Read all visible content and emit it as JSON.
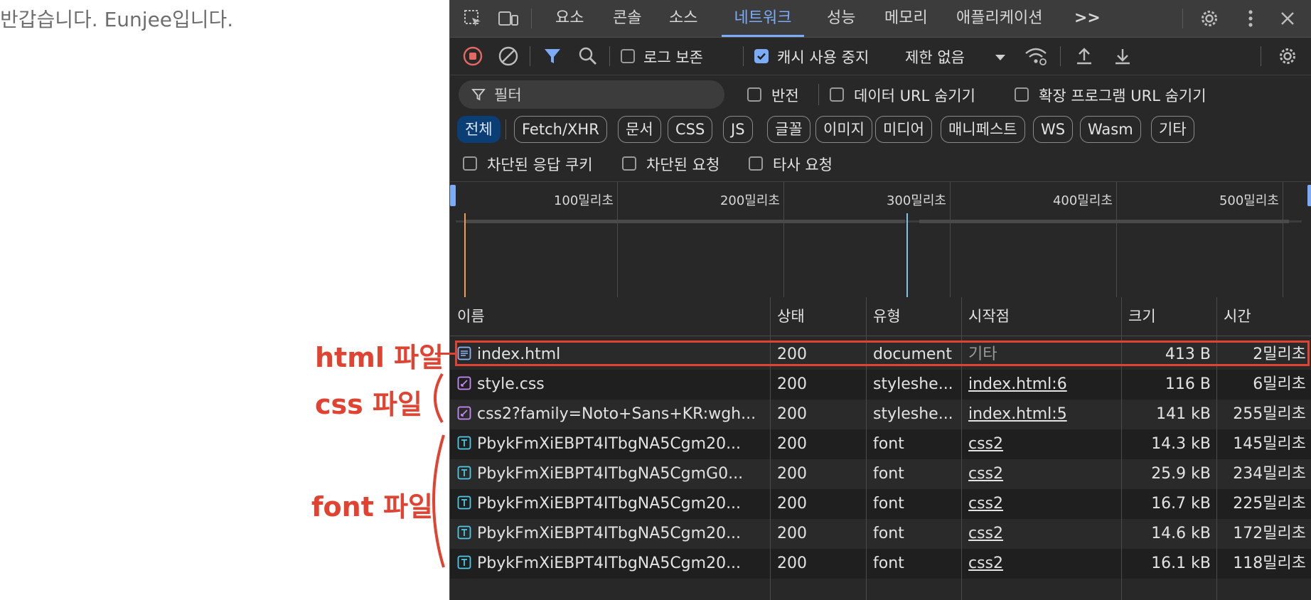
{
  "page": {
    "text": "반갑습니다. Eunjee입니다."
  },
  "devtools": {
    "tabs": [
      {
        "label": "요소",
        "active": false
      },
      {
        "label": "콘솔",
        "active": false
      },
      {
        "label": "소스",
        "active": false
      },
      {
        "label": "네트워크",
        "active": true
      },
      {
        "label": "성능",
        "active": false
      },
      {
        "label": "메모리",
        "active": false
      },
      {
        "label": "애플리케이션",
        "active": false
      }
    ],
    "more_tabs": ">>",
    "toolbar": {
      "preserve_log_label": "로그 보존",
      "preserve_log_checked": false,
      "disable_cache_label": "캐시 사용 중지",
      "disable_cache_checked": true,
      "throttling_value": "제한 없음"
    },
    "filter": {
      "placeholder": "필터",
      "invert_label": "반전",
      "hide_data_urls_label": "데이터 URL 숨기기",
      "hide_ext_urls_label": "확장 프로그램 URL 숨기기"
    },
    "type_chips": [
      "전체",
      "Fetch/XHR",
      "문서",
      "CSS",
      "JS",
      "글꼴",
      "이미지",
      "미디어",
      "매니페스트",
      "WS",
      "Wasm",
      "기타"
    ],
    "active_chip": "전체",
    "options": {
      "blocked_cookies_label": "차단된 응답 쿠키",
      "blocked_requests_label": "차단된 요청",
      "third_party_label": "타사 요청"
    },
    "timeline": {
      "ticks": [
        "100밀리초",
        "200밀리초",
        "300밀리초",
        "400밀리초",
        "500밀리초"
      ]
    },
    "table": {
      "headers": [
        "이름",
        "상태",
        "유형",
        "시작점",
        "크기",
        "시간"
      ],
      "rows": [
        {
          "icon": "document",
          "name": "index.html",
          "status": "200",
          "type": "document",
          "initiator": "기타",
          "initiator_link": false,
          "size": "413 B",
          "time": "2밀리초"
        },
        {
          "icon": "stylesheet",
          "name": "style.css",
          "status": "200",
          "type": "styleshe...",
          "initiator": "index.html:6",
          "initiator_link": true,
          "size": "116 B",
          "time": "6밀리초"
        },
        {
          "icon": "stylesheet",
          "name": "css2?family=Noto+Sans+KR:wgh...",
          "status": "200",
          "type": "styleshe...",
          "initiator": "index.html:5",
          "initiator_link": true,
          "size": "141 kB",
          "time": "255밀리초"
        },
        {
          "icon": "font",
          "name": "PbykFmXiEBPT4ITbgNA5Cgm20...",
          "status": "200",
          "type": "font",
          "initiator": "css2",
          "initiator_link": true,
          "size": "14.3 kB",
          "time": "145밀리초"
        },
        {
          "icon": "font",
          "name": "PbykFmXiEBPT4ITbgNA5CgmG0...",
          "status": "200",
          "type": "font",
          "initiator": "css2",
          "initiator_link": true,
          "size": "25.9 kB",
          "time": "234밀리초"
        },
        {
          "icon": "font",
          "name": "PbykFmXiEBPT4ITbgNA5Cgm20...",
          "status": "200",
          "type": "font",
          "initiator": "css2",
          "initiator_link": true,
          "size": "16.7 kB",
          "time": "225밀리초"
        },
        {
          "icon": "font",
          "name": "PbykFmXiEBPT4ITbgNA5Cgm20...",
          "status": "200",
          "type": "font",
          "initiator": "css2",
          "initiator_link": true,
          "size": "14.6 kB",
          "time": "172밀리초"
        },
        {
          "icon": "font",
          "name": "PbykFmXiEBPT4ITbgNA5Cgm20...",
          "status": "200",
          "type": "font",
          "initiator": "css2",
          "initiator_link": true,
          "size": "16.1 kB",
          "time": "118밀리초"
        }
      ]
    }
  },
  "annotations": {
    "html_label": "html 파일",
    "css_label": "css 파일",
    "font_label": "font 파일"
  },
  "colors": {
    "annotation": "#e04331",
    "accent": "#7cacf8",
    "record": "#e46962",
    "doc_icon": "#8ab4f8",
    "css_icon": "#c58af9",
    "font_icon": "#4ec9e6"
  }
}
